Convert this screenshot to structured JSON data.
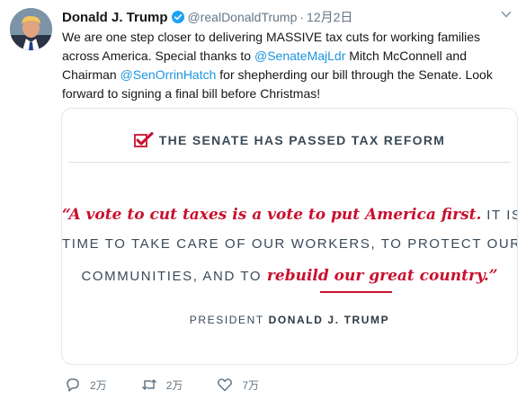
{
  "tweet": {
    "display_name": "Donald J. Trump",
    "handle": "@realDonaldTrump",
    "separator": "·",
    "time": "12月2日",
    "text": {
      "part1": "We are one step closer to delivering MASSIVE tax cuts for working families across America. Special thanks to ",
      "mention1": "@SenateMajLdr",
      "part2": " Mitch McConnell and Chairman ",
      "mention2": "@SenOrrinHatch",
      "part3": " for shepherding our bill through the Senate. Look forward to signing a final bill before Christmas!"
    }
  },
  "card": {
    "banner": "THE SENATE HAS PASSED TAX REFORM",
    "quote_red": "“A vote to cut taxes is a vote to put America first.",
    "quote_caps1": " IT IS",
    "quote_line2": "TIME TO TAKE CARE OF OUR WORKERS, TO PROTECT OUR",
    "quote_line3_caps": "COMMUNITIES, AND TO ",
    "quote_line3_red": "rebuild our great country.”",
    "attribution_prefix": "PRESIDENT ",
    "attribution_name": "DONALD J. TRUMP"
  },
  "actions": {
    "reply_count": "2万",
    "retweet_count": "2万",
    "like_count": "7万"
  },
  "colors": {
    "accent": "#1b95e0",
    "brand_red": "#c8102e",
    "muted": "#657786"
  },
  "icons": [
    "verified-badge-icon",
    "caret-down-icon",
    "checkmark-icon",
    "reply-icon",
    "retweet-icon",
    "heart-icon"
  ]
}
